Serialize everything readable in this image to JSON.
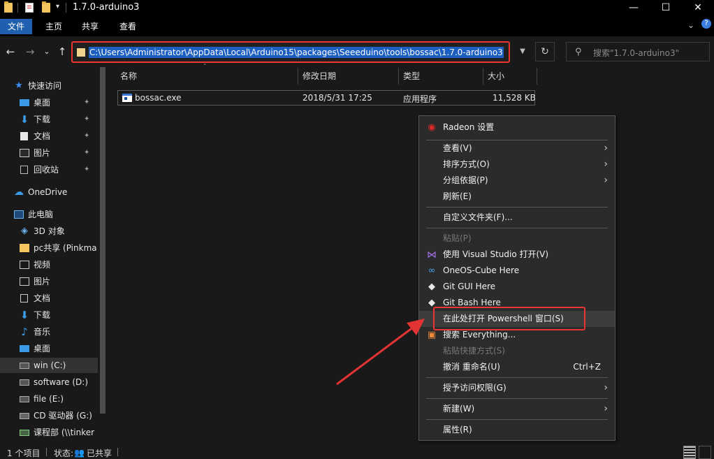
{
  "window": {
    "title": "1.7.0-arduino3",
    "minimize": "—",
    "maximize": "☐",
    "close": "✕"
  },
  "ribbon": {
    "tabs": [
      "文件",
      "主页",
      "共享",
      "查看"
    ],
    "help_glyph": "?",
    "collapse_glyph": "⌄"
  },
  "nav": {
    "back": "←",
    "forward": "→",
    "recent": "⌄",
    "up": "↑",
    "address": "C:\\Users\\Administrator\\AppData\\Local\\Arduino15\\packages\\Seeeduino\\tools\\bossac\\1.7.0-arduino3",
    "dropdown": "▼",
    "refresh": "↻",
    "search_placeholder": "搜索\"1.7.0-arduino3\""
  },
  "sidebar": {
    "quick_access": "快速访问",
    "quick_items": [
      {
        "label": "桌面",
        "icon": "desktop-icon"
      },
      {
        "label": "下载",
        "icon": "download-icon"
      },
      {
        "label": "文档",
        "icon": "document-icon"
      },
      {
        "label": "图片",
        "icon": "picture-icon"
      },
      {
        "label": "回收站",
        "icon": "recycle-bin-icon"
      }
    ],
    "pin_glyph": "📌",
    "onedrive": "OneDrive",
    "this_pc": "此电脑",
    "pc_items": [
      {
        "label": "3D 对象",
        "icon": "3d-objects-icon"
      },
      {
        "label": "pc共享 (Pinkma",
        "icon": "shared-folder-icon"
      },
      {
        "label": "视频",
        "icon": "video-icon"
      },
      {
        "label": "图片",
        "icon": "picture-icon"
      },
      {
        "label": "文档",
        "icon": "document-icon"
      },
      {
        "label": "下载",
        "icon": "download-icon"
      },
      {
        "label": "音乐",
        "icon": "music-icon"
      },
      {
        "label": "桌面",
        "icon": "desktop-icon"
      },
      {
        "label": "win (C:)",
        "icon": "drive-icon"
      },
      {
        "label": "software (D:)",
        "icon": "drive-icon"
      },
      {
        "label": "file (E:)",
        "icon": "drive-icon"
      },
      {
        "label": "CD 驱动器 (G:)",
        "icon": "cd-drive-icon"
      },
      {
        "label": "课程部 (\\\\tinker",
        "icon": "network-drive-icon"
      }
    ]
  },
  "columns": {
    "name": "名称",
    "modified": "修改日期",
    "type": "类型",
    "size": "大小"
  },
  "files": [
    {
      "name": "bossac.exe",
      "modified": "2018/5/31 17:25",
      "type": "应用程序",
      "size": "11,528 KB"
    }
  ],
  "context_menu": {
    "items": [
      {
        "label": "Radeon 设置",
        "icon": "radeon-icon"
      },
      {
        "label": "查看(V)",
        "arrow": true
      },
      {
        "label": "排序方式(O)",
        "arrow": true
      },
      {
        "label": "分组依据(P)",
        "arrow": true
      },
      {
        "label": "刷新(E)"
      },
      {
        "label": "自定义文件夹(F)..."
      },
      {
        "label": "粘贴(P)",
        "disabled": true
      },
      {
        "label": "使用 Visual Studio 打开(V)",
        "icon": "visual-studio-icon"
      },
      {
        "label": "OneOS-Cube Here",
        "icon": "oneos-cube-icon"
      },
      {
        "label": "Git GUI Here",
        "icon": "git-gui-icon"
      },
      {
        "label": "Git Bash Here",
        "icon": "git-bash-icon"
      },
      {
        "label": "在此处打开 Powershell 窗口(S)"
      },
      {
        "label": "搜索 Everything...",
        "icon": "everything-icon"
      },
      {
        "label": "粘贴快捷方式(S)",
        "disabled": true
      },
      {
        "label": "撤消 重命名(U)",
        "shortcut": "Ctrl+Z"
      },
      {
        "label": "授予访问权限(G)",
        "arrow": true
      },
      {
        "label": "新建(W)",
        "arrow": true
      },
      {
        "label": "属性(R)"
      }
    ],
    "arrow_glyph": "›"
  },
  "status": {
    "count": "1 个项目",
    "state_label": "状态:",
    "state_value": "已共享"
  },
  "colors": {
    "highlight_red": "#e33333",
    "selection_blue": "#1c5fc0",
    "folder_yellow": "#f3c55e"
  }
}
